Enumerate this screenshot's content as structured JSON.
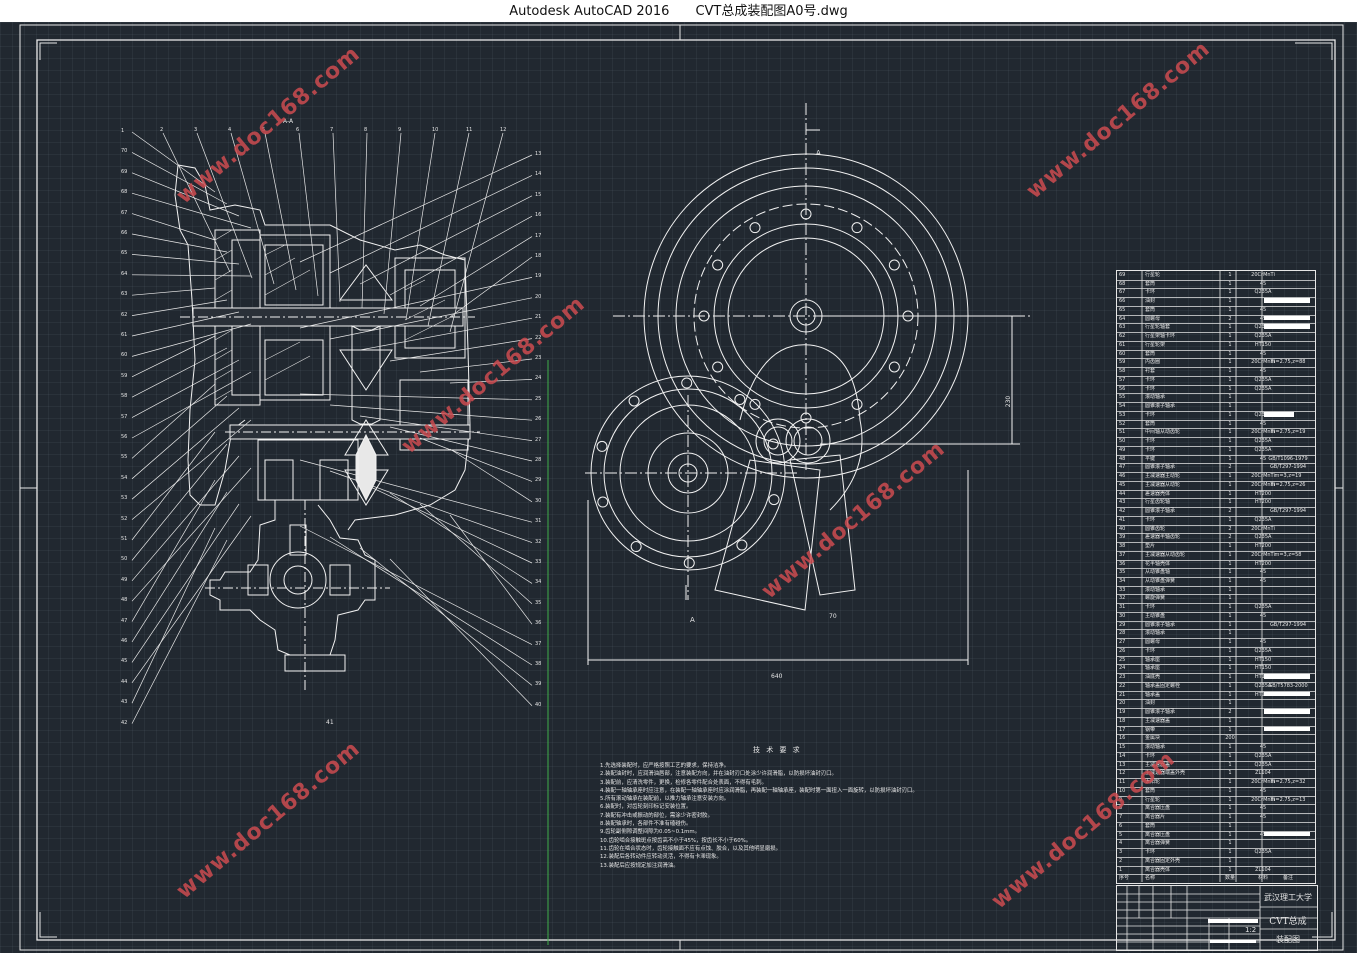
{
  "window": {
    "app_title": "Autodesk AutoCAD 2016",
    "file_title": "CVT总成装配图A0号.dwg"
  },
  "drawing": {
    "section_label": "A-A",
    "section_arrow_label": "A",
    "dim_height": "230",
    "dim_width": "640",
    "dim_small": "70",
    "left_callouts": [
      "1",
      "70",
      "69",
      "68",
      "67",
      "66",
      "65",
      "64",
      "63",
      "62",
      "61",
      "60",
      "59",
      "58",
      "57",
      "56",
      "55",
      "54",
      "53",
      "52",
      "51",
      "50",
      "49",
      "48",
      "47",
      "46",
      "45",
      "44",
      "43",
      "42"
    ],
    "top_callouts": [
      "2",
      "3",
      "4",
      "5",
      "6",
      "7",
      "8",
      "9",
      "10",
      "11",
      "12"
    ],
    "right_callouts": [
      "13",
      "14",
      "15",
      "16",
      "17",
      "18",
      "19",
      "20",
      "21",
      "22",
      "23",
      "24",
      "25",
      "26",
      "27",
      "28",
      "29",
      "30",
      "31",
      "32",
      "33",
      "34",
      "35",
      "36",
      "37",
      "38",
      "39",
      "40"
    ],
    "bottom_callout": "41"
  },
  "notes": {
    "title": "技 术 要 求",
    "items": [
      "1.先选择装配时，应严格按照工艺的要求，保持洁净。",
      "2.装配油封时，应润滑油唇部，注意装配方向，并在油封刃口处涂少许润滑脂，以防损坏油封刃口。",
      "3.装配前，应清洗零件，更换，检修各零件配合处表面，不得有毛刺。",
      "4.装配一轴轴承座时应注意，在装配一轴轴承座时应涂润滑脂，再装配一轴轴承座，装配时第一面扭入一面旋转，以防损坏油封刃口。",
      "5.所有滚动轴承在装配前，以推力轴承注意安装方向。",
      "6.装配时，对齿轮刻印标记安装位置。",
      "7.装配有冲击或振动的部位，需涂少许密封胶。",
      "8.装配轴承时，各部件不准有磕碰伤。",
      "9.齿轮副侧隙调整间隙为0.05~0.1mm。",
      "10.齿轮啮合接触斑点按齿高不小于45%，按齿长不小于60%。",
      "11.齿轮在啮合状态时，齿轮接触面不应有点蚀、胶合，以及其他明显磨损。",
      "12.装配后各转动件应转动灵活，不得有卡滞现象。",
      "13.装配后应按规定加注润滑油。"
    ]
  },
  "bom": {
    "rows": [
      [
        "69",
        "行星轮",
        "1",
        "20CrMnTi",
        ""
      ],
      [
        "68",
        "套筒",
        "1",
        "45",
        ""
      ],
      [
        "67",
        "卡环",
        "1",
        "Q235A",
        ""
      ],
      [
        "66",
        "油封",
        "1",
        "",
        ""
      ],
      [
        "65",
        "套筒",
        "1",
        "45",
        ""
      ],
      [
        "64",
        "圆螺母",
        "2",
        "45",
        ""
      ],
      [
        "63",
        "行星轮轴套",
        "1",
        "Q235A",
        ""
      ],
      [
        "62",
        "行星架轴卡环",
        "1",
        "Q235A",
        ""
      ],
      [
        "61",
        "行星轮架",
        "1",
        "HT150",
        ""
      ],
      [
        "60",
        "套筒",
        "1",
        "45",
        ""
      ],
      [
        "59",
        "内齿圈",
        "1",
        "20CrMnTi",
        "m=2.75,z=88"
      ],
      [
        "58",
        "衬套",
        "1",
        "45",
        ""
      ],
      [
        "57",
        "卡环",
        "1",
        "Q235A",
        ""
      ],
      [
        "56",
        "卡环",
        "1",
        "Q235A",
        ""
      ],
      [
        "55",
        "滚动轴承",
        "1",
        "",
        ""
      ],
      [
        "54",
        "圆锥滚子轴承",
        "1",
        "",
        ""
      ],
      [
        "53",
        "卡环",
        "1",
        "Q235A",
        ""
      ],
      [
        "52",
        "套筒",
        "1",
        "45",
        ""
      ],
      [
        "51",
        "中间轴从动齿轮",
        "1",
        "20CrMnTi",
        "m=2.75,z=19"
      ],
      [
        "50",
        "卡环",
        "1",
        "Q235A",
        ""
      ],
      [
        "49",
        "卡环",
        "1",
        "Q235A",
        ""
      ],
      [
        "48",
        "平键",
        "1",
        "45",
        "GB/T1096-1979"
      ],
      [
        "47",
        "圆锥滚子轴承",
        "2",
        "",
        "GB/T297-1994"
      ],
      [
        "46",
        "主减速器主动轮",
        "1",
        "20CrMnTi",
        "m=3,z=19"
      ],
      [
        "45",
        "主减速器从动轮",
        "1",
        "20CrMnTi",
        "m=2.75,z=26"
      ],
      [
        "44",
        "差速器壳体",
        "1",
        "HT200",
        ""
      ],
      [
        "43",
        "行星齿轮轴",
        "1",
        "HT200",
        ""
      ],
      [
        "42",
        "圆锥滚子轴承",
        "2",
        "",
        "GB/T297-1994"
      ],
      [
        "41",
        "卡环",
        "1",
        "Q235A",
        ""
      ],
      [
        "40",
        "圆锥齿轮",
        "2",
        "20CrMnTi",
        ""
      ],
      [
        "39",
        "差速器半轴齿轮",
        "2",
        "Q235A",
        ""
      ],
      [
        "38",
        "垫片",
        "1",
        "HT200",
        ""
      ],
      [
        "37",
        "主减速器从动齿轮",
        "1",
        "20CrMnTi",
        "m=3,z=58"
      ],
      [
        "36",
        "花半轴壳体",
        "1",
        "HT200",
        ""
      ],
      [
        "35",
        "从动锥盘轴",
        "1",
        "45",
        ""
      ],
      [
        "34",
        "从动锥盘弹簧",
        "1",
        "45",
        ""
      ],
      [
        "33",
        "滚动轴承",
        "1",
        "",
        ""
      ],
      [
        "32",
        "螺旋弹簧",
        "1",
        "",
        ""
      ],
      [
        "31",
        "卡环",
        "1",
        "Q235A",
        ""
      ],
      [
        "30",
        "主动锥盘",
        "1",
        "45",
        ""
      ],
      [
        "29",
        "圆锥滚子轴承",
        "1",
        "",
        "GB/T297-1994"
      ],
      [
        "28",
        "滚动轴承",
        "1",
        "",
        ""
      ],
      [
        "27",
        "圆螺母",
        "1",
        "45",
        ""
      ],
      [
        "26",
        "卡环",
        "1",
        "Q235A",
        ""
      ],
      [
        "25",
        "轴承座",
        "1",
        "HT150",
        ""
      ],
      [
        "24",
        "轴承座",
        "1",
        "HT150",
        ""
      ],
      [
        "23",
        "油底壳",
        "1",
        "HT150",
        ""
      ],
      [
        "22",
        "轴承盖固定螺栓",
        "1",
        "Q235A",
        "GB/T5783-2000"
      ],
      [
        "21",
        "轴承盖",
        "1",
        "HT150",
        ""
      ],
      [
        "20",
        "油封",
        "1",
        "",
        ""
      ],
      [
        "19",
        "圆锥滚子轴承",
        "2",
        "",
        ""
      ],
      [
        "18",
        "主减速器盖",
        "1",
        "",
        ""
      ],
      [
        "17",
        "钢带",
        "1",
        "",
        ""
      ],
      [
        "16",
        "金属块",
        "200",
        "",
        ""
      ],
      [
        "15",
        "滚动轴承",
        "1",
        "45",
        ""
      ],
      [
        "14",
        "卡环",
        "1",
        "Q235A",
        ""
      ],
      [
        "13",
        "主减速器盖",
        "1",
        "Q235A",
        ""
      ],
      [
        "12",
        "主减速器端盖外壳",
        "1",
        "ZL104",
        ""
      ],
      [
        "11",
        "太阳轮",
        "1",
        "20CrMnTi",
        "m=2.75,z=32"
      ],
      [
        "10",
        "套筒",
        "1",
        "45",
        ""
      ],
      [
        "9",
        "行星轮",
        "1",
        "20CrMnTi",
        "m=2.75,z=13"
      ],
      [
        "8",
        "离合器压盘",
        "1",
        "45",
        ""
      ],
      [
        "7",
        "离合器片",
        "1",
        "45",
        ""
      ],
      [
        "6",
        "套筒",
        "1",
        "",
        ""
      ],
      [
        "5",
        "离合器压盘",
        "1",
        "45",
        ""
      ],
      [
        "4",
        "离合器弹簧",
        "1",
        "",
        ""
      ],
      [
        "3",
        "卡环",
        "1",
        "Q235A",
        ""
      ],
      [
        "2",
        "离合器固定外壳",
        "1",
        "",
        ""
      ],
      [
        "1",
        "离合器壳体",
        "1",
        "ZL104",
        ""
      ]
    ],
    "header": [
      "序号",
      "名称",
      "数量",
      "材料",
      "备注"
    ]
  },
  "title_block": {
    "school": "武汉理工大学",
    "drawing_name": "CVT总成",
    "drawing_type": "装配图",
    "scale": "1:2"
  },
  "watermark": {
    "text": "www.doc168.com",
    "color": "#cd4b50"
  }
}
